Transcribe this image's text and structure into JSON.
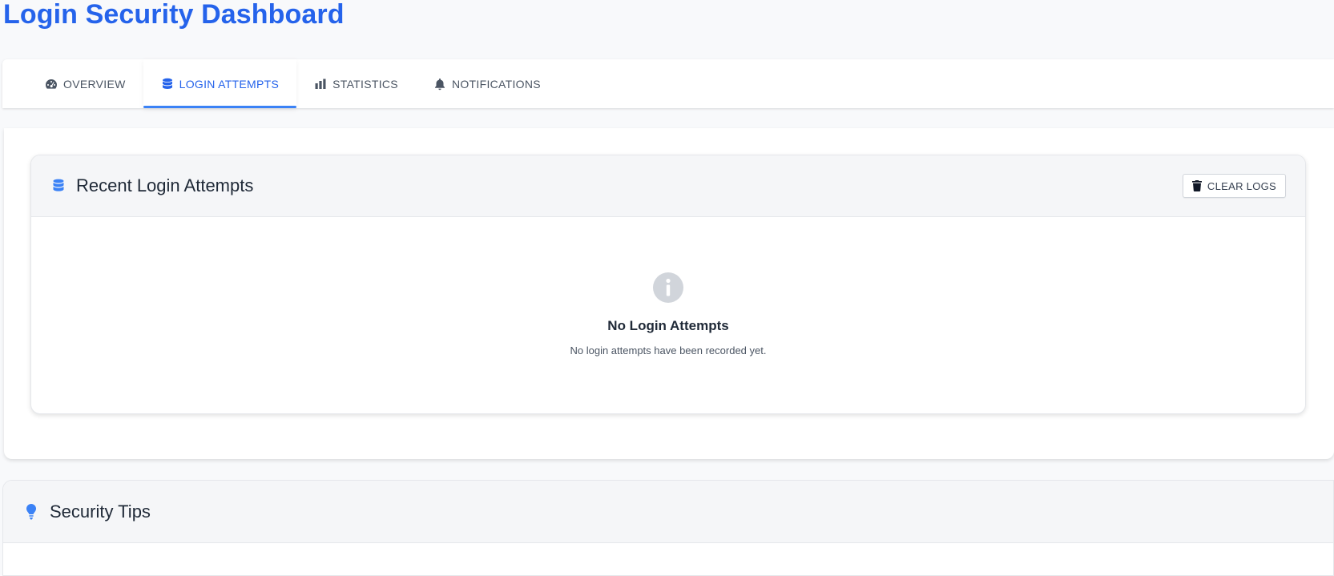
{
  "page": {
    "title": "Login Security Dashboard"
  },
  "tabs": [
    {
      "label": "OVERVIEW",
      "icon": "dashboard-gauge-icon",
      "active": false
    },
    {
      "label": "LOGIN ATTEMPTS",
      "icon": "database-icon",
      "active": true
    },
    {
      "label": "STATISTICS",
      "icon": "bar-chart-icon",
      "active": false
    },
    {
      "label": "NOTIFICATIONS",
      "icon": "bell-icon",
      "active": false
    }
  ],
  "login_attempts": {
    "title": "Recent Login Attempts",
    "icon": "database-icon",
    "clear_button": {
      "label": "CLEAR LOGS",
      "icon": "trash-icon"
    },
    "empty_state": {
      "icon": "info-circle-icon",
      "title": "No Login Attempts",
      "description": "No login attempts have been recorded yet."
    }
  },
  "security_tips": {
    "title": "Security Tips",
    "icon": "lightbulb-icon"
  },
  "colors": {
    "accent": "#2563eb",
    "accent_light": "#3b82f6",
    "muted_icon": "#d1d5db",
    "header_bg": "#f5f6f8"
  }
}
